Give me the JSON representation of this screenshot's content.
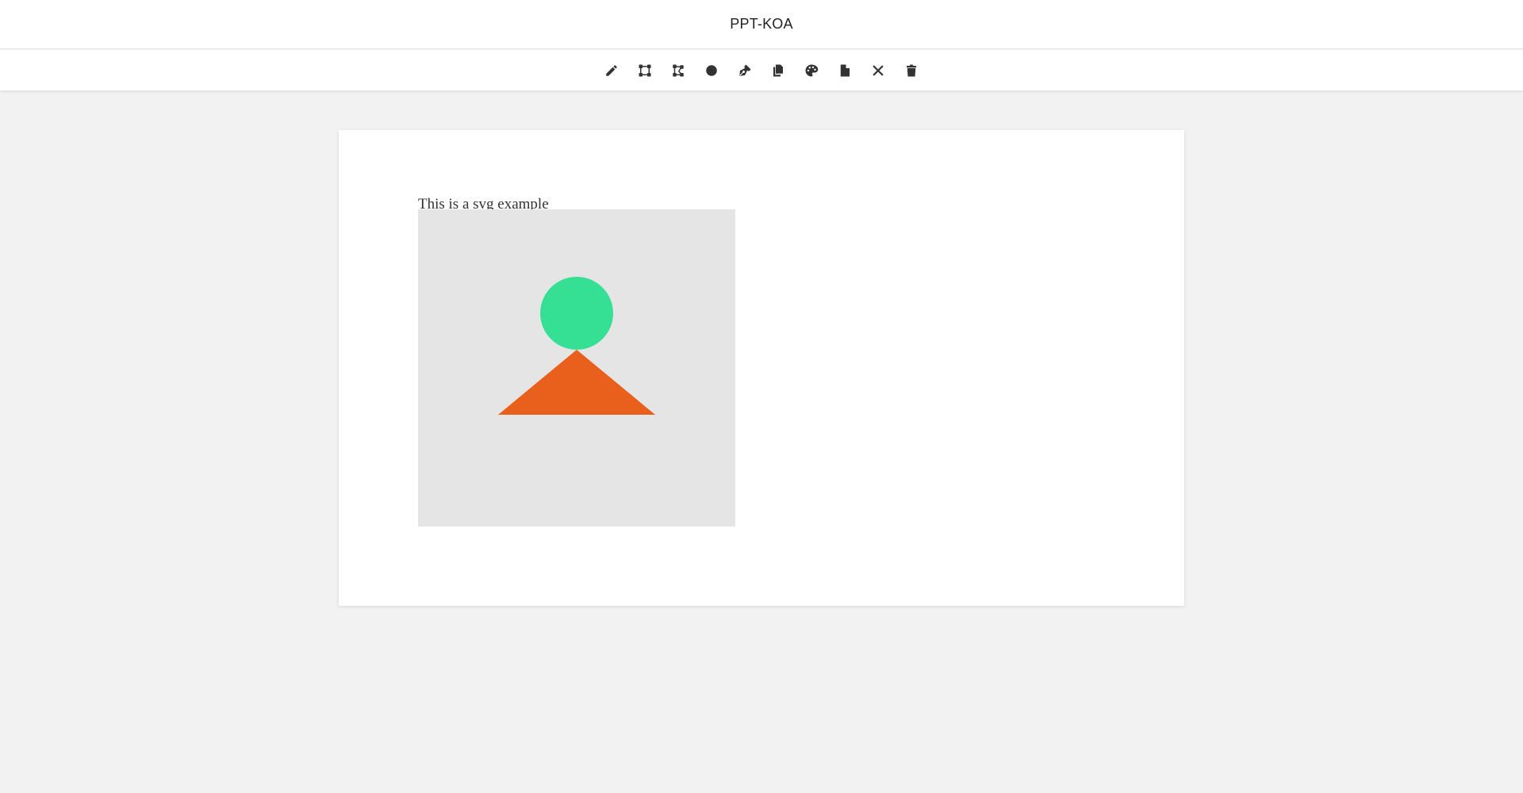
{
  "app": {
    "title": "PPT-KOA"
  },
  "toolbar": {
    "tools": [
      {
        "name": "pencil-icon",
        "tooltip": ""
      },
      {
        "name": "vector-square-icon",
        "tooltip": ""
      },
      {
        "name": "draw-polygon-icon",
        "tooltip": ""
      },
      {
        "name": "circle-icon",
        "tooltip": ""
      },
      {
        "name": "pen-nib-icon",
        "tooltip": ""
      },
      {
        "name": "copy-icon",
        "tooltip": ""
      },
      {
        "name": "palette-icon",
        "tooltip": ""
      },
      {
        "name": "file-icon",
        "tooltip": ""
      },
      {
        "name": "close-icon",
        "tooltip": ""
      },
      {
        "name": "trash-icon",
        "tooltip": ""
      }
    ],
    "icon_color": "#333333"
  },
  "slide": {
    "caption": "This is a svg example",
    "svg_background": "#e5e5e5",
    "shapes": {
      "circle_color": "#35e095",
      "triangle_color": "#e8601c"
    }
  }
}
